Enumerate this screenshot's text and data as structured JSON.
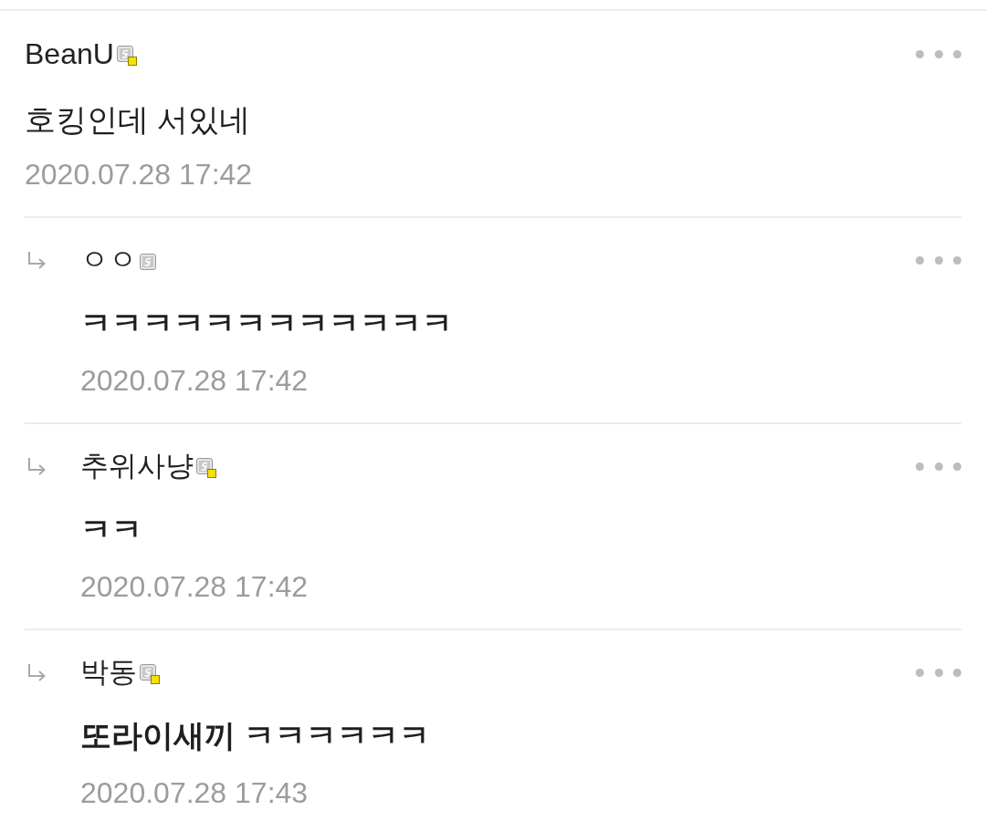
{
  "comments": [
    {
      "author": "BeanU",
      "icon_badge": true,
      "text": "호킹인데 서있네",
      "date": "2020.07.28 17:42",
      "replies": [
        {
          "author": "ㅇㅇ",
          "icon_badge": false,
          "text": "ㅋㅋㅋㅋㅋㅋㅋㅋㅋㅋㅋㅋ",
          "date": "2020.07.28 17:42"
        },
        {
          "author": "추위사냥",
          "icon_badge": true,
          "text": "ㅋㅋ",
          "date": "2020.07.28 17:42"
        },
        {
          "author": "박동",
          "icon_badge": true,
          "text": "또라이새끼 ㅋㅋㅋㅋㅋㅋ",
          "date": "2020.07.28 17:43"
        }
      ]
    }
  ]
}
